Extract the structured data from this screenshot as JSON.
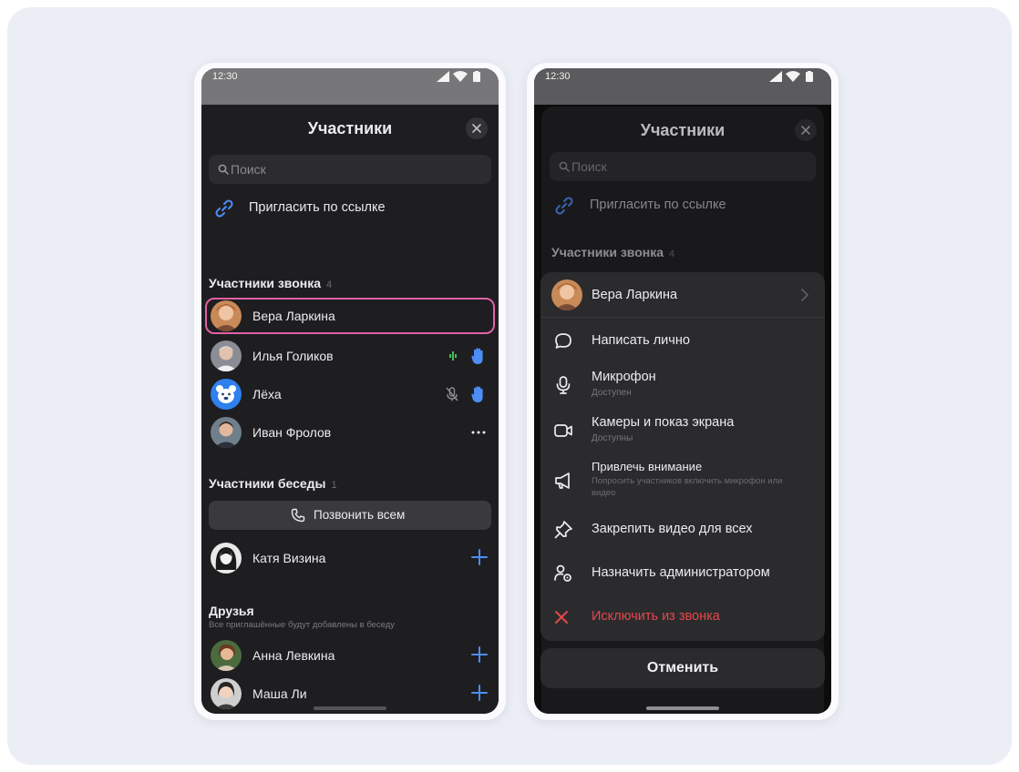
{
  "colors": {
    "highlight": "#e35fa8",
    "accent_blue": "#4c8df6",
    "danger": "#e6484b",
    "mic_green": "#3fc15a"
  },
  "status": {
    "time": "12:30"
  },
  "left": {
    "title": "Участники",
    "search_placeholder": "Поиск",
    "invite_label": "Пригласить по ссылке",
    "call_section": {
      "title": "Участники звонка",
      "count": "4"
    },
    "call_participants": [
      {
        "name": "Вера Ларкина",
        "icons": []
      },
      {
        "name": "Илья Голиков",
        "icons": [
          "mic-active-icon",
          "raised-hand-icon"
        ]
      },
      {
        "name": "Лёха",
        "icons": [
          "mic-muted-icon",
          "raised-hand-icon"
        ]
      },
      {
        "name": "Иван Фролов",
        "icons": [
          "more-dots-icon"
        ]
      }
    ],
    "chat_section": {
      "title": "Участники беседы",
      "count": "1"
    },
    "call_all_label": "Позвонить всем",
    "chat_participants": [
      {
        "name": "Катя Визина",
        "icon": "plus-icon"
      }
    ],
    "friends_section": {
      "title": "Друзья",
      "note": "Все приглашённые будут добавлены в беседу"
    },
    "friends": [
      {
        "name": "Анна Левкина",
        "icon": "plus-icon"
      },
      {
        "name": "Маша Ли",
        "icon": "plus-icon"
      }
    ]
  },
  "right": {
    "title": "Участники",
    "search_placeholder": "Поиск",
    "invite_label": "Пригласить по ссылке",
    "call_section": {
      "title": "Участники звонка",
      "count": "4"
    },
    "menu": {
      "person_name": "Вера Ларкина",
      "items": [
        {
          "label": "Написать лично",
          "sub": "",
          "icon": "message-icon"
        },
        {
          "label": "Микрофон",
          "sub": "Доступен",
          "icon": "microphone-icon"
        },
        {
          "label": "Камеры и показ экрана",
          "sub": "Доступны",
          "icon": "camera-icon"
        },
        {
          "label": "Привлечь внимание",
          "sub": "Попросить участников включить микрофон или видео",
          "icon": "megaphone-icon"
        },
        {
          "label": "Закрепить видео для всех",
          "sub": "",
          "icon": "pin-icon"
        },
        {
          "label": "Назначить администратором",
          "sub": "",
          "icon": "admin-icon"
        },
        {
          "label": "Исключить из звонка",
          "sub": "",
          "icon": "close-red-icon"
        }
      ]
    },
    "cancel_label": "Отменить"
  }
}
